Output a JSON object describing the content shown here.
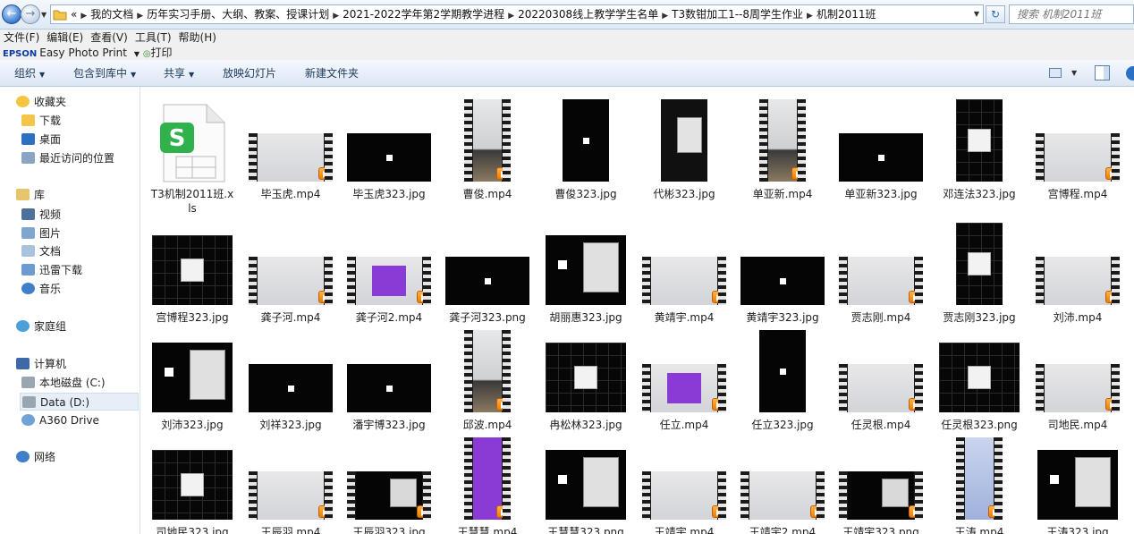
{
  "address": {
    "crumbs": [
      "«",
      "我的文档",
      "历年实习手册、大纲、教案、授课计划",
      "2021-2022学年第2学期教学进程",
      "20220308线上教学学生名单",
      "T3数钳加工1--8周学生作业",
      "机制2011班"
    ],
    "search_placeholder": "搜索 机制2011班"
  },
  "menu": [
    "文件(F)",
    "编辑(E)",
    "查看(V)",
    "工具(T)",
    "帮助(H)"
  ],
  "epson": {
    "brand": "EPSON",
    "product": "Easy Photo Print",
    "print": "打印"
  },
  "commands": [
    "组织",
    "包含到库中",
    "共享",
    "放映幻灯片",
    "新建文件夹"
  ],
  "sidebar": {
    "favorites": "收藏夹",
    "fav_items": [
      "下载",
      "桌面",
      "最近访问的位置"
    ],
    "libraries": "库",
    "lib_items": [
      "视频",
      "图片",
      "文档",
      "迅雷下载",
      "音乐"
    ],
    "homegroup": "家庭组",
    "computer": "计算机",
    "drives": [
      "本地磁盘 (C:)",
      "Data (D:)",
      "A360 Drive"
    ],
    "network": "网络"
  },
  "files": [
    {
      "name": "T3机制2011班.xls",
      "kind": "xls"
    },
    {
      "name": "毕玉虎.mp4",
      "kind": "video"
    },
    {
      "name": "毕玉虎323.jpg",
      "kind": "black"
    },
    {
      "name": "曹俊.mp4",
      "kind": "video-tall"
    },
    {
      "name": "曹俊323.jpg",
      "kind": "black-tall"
    },
    {
      "name": "代彬323.jpg",
      "kind": "tall-screen"
    },
    {
      "name": "单亚新.mp4",
      "kind": "video-tall"
    },
    {
      "name": "单亚新323.jpg",
      "kind": "black"
    },
    {
      "name": "邓连法323.jpg",
      "kind": "grid-tall"
    },
    {
      "name": "宫博程.mp4",
      "kind": "video"
    },
    {
      "name": "宫博程323.jpg",
      "kind": "grid"
    },
    {
      "name": "龚子河.mp4",
      "kind": "video"
    },
    {
      "name": "龚子河2.mp4",
      "kind": "video-purple"
    },
    {
      "name": "龚子河323.png",
      "kind": "black"
    },
    {
      "name": "胡丽惠323.jpg",
      "kind": "panel"
    },
    {
      "name": "黄靖宇.mp4",
      "kind": "video"
    },
    {
      "name": "黄靖宇323.jpg",
      "kind": "black"
    },
    {
      "name": "贾志刚.mp4",
      "kind": "video"
    },
    {
      "name": "贾志刚323.jpg",
      "kind": "grid-tall"
    },
    {
      "name": "刘沛.mp4",
      "kind": "video"
    },
    {
      "name": "刘沛323.jpg",
      "kind": "panel"
    },
    {
      "name": "刘祥323.jpg",
      "kind": "black"
    },
    {
      "name": "潘宇博323.jpg",
      "kind": "black"
    },
    {
      "name": "邱波.mp4",
      "kind": "video-tall"
    },
    {
      "name": "冉松林323.jpg",
      "kind": "grid"
    },
    {
      "name": "任立.mp4",
      "kind": "video-purple"
    },
    {
      "name": "任立323.jpg",
      "kind": "black-tall"
    },
    {
      "name": "任灵根.mp4",
      "kind": "video"
    },
    {
      "name": "任灵根323.png",
      "kind": "grid"
    },
    {
      "name": "司地民.mp4",
      "kind": "video"
    },
    {
      "name": "司地民323.jpg",
      "kind": "grid"
    },
    {
      "name": "王辰羽.mp4",
      "kind": "video"
    },
    {
      "name": "王辰羽323.jpg",
      "kind": "video-panel"
    },
    {
      "name": "王慧慧.mp4",
      "kind": "video-tall-purple"
    },
    {
      "name": "王慧慧323.png",
      "kind": "panel"
    },
    {
      "name": "王靖宇.mp4",
      "kind": "video"
    },
    {
      "name": "王靖宇2.mp4",
      "kind": "video"
    },
    {
      "name": "王靖宇323.png",
      "kind": "video-panel"
    },
    {
      "name": "王涛.mp4",
      "kind": "video-tall-blue"
    },
    {
      "name": "王涛323.jpg",
      "kind": "panel"
    }
  ]
}
